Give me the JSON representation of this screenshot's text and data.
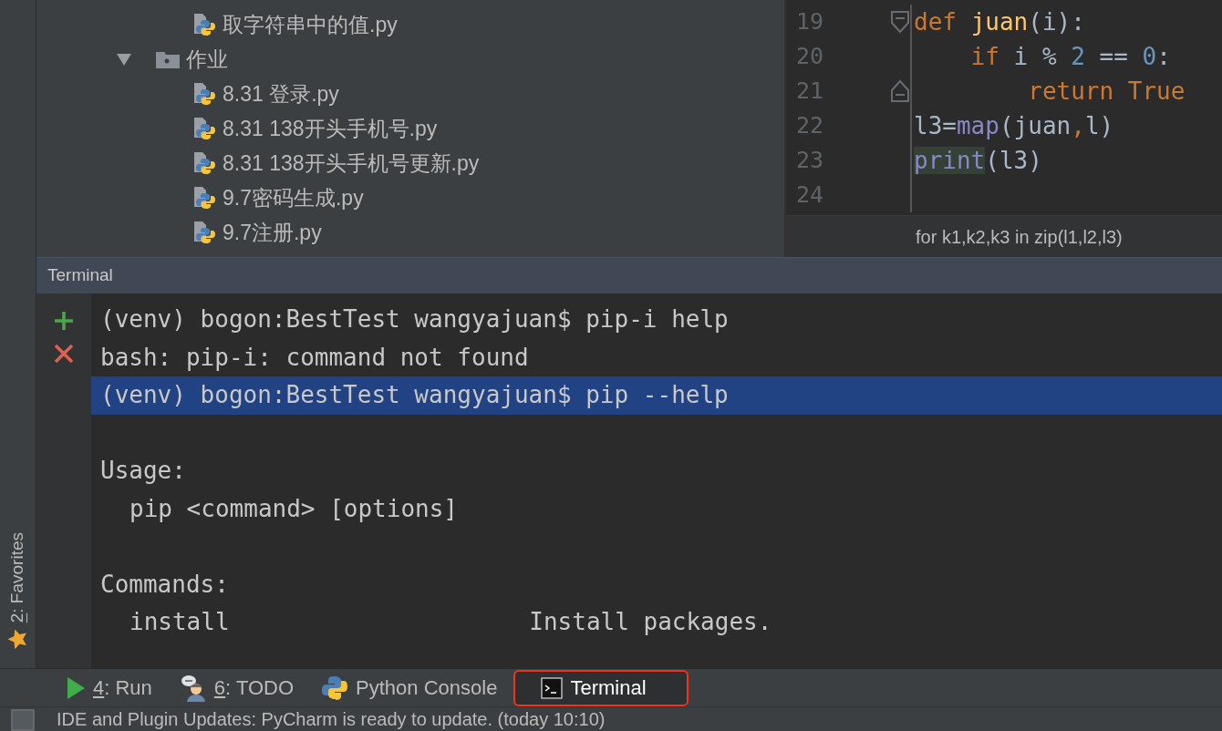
{
  "left_stripe": {
    "favorites": {
      "mnemonic": "2",
      "label": ": Favorites"
    }
  },
  "project_tree": {
    "items": [
      {
        "kind": "file",
        "label": "取字符串中的值.py"
      },
      {
        "kind": "folder",
        "label": "作业",
        "expanded": true,
        "children": [
          {
            "kind": "file",
            "label": "8.31 登录.py"
          },
          {
            "kind": "file",
            "label": "8.31 138开头手机号.py"
          },
          {
            "kind": "file",
            "label": "8.31 138开头手机号更新.py"
          },
          {
            "kind": "file",
            "label": "9.7密码生成.py"
          },
          {
            "kind": "file",
            "label": "9.7注册.py"
          }
        ]
      }
    ]
  },
  "editor": {
    "lines": [
      {
        "number": "19",
        "fold_start": true,
        "fold_end": false,
        "tokens": [
          {
            "kind": "keyword",
            "text": "def "
          },
          {
            "kind": "function",
            "text": "juan"
          },
          {
            "kind": "plain",
            "text": "(i):"
          }
        ]
      },
      {
        "number": "20",
        "fold_start": false,
        "fold_end": false,
        "tokens": [
          {
            "kind": "keyword",
            "text": "    if "
          },
          {
            "kind": "plain",
            "text": "i % "
          },
          {
            "kind": "number",
            "text": "2"
          },
          {
            "kind": "plain",
            "text": " == "
          },
          {
            "kind": "number",
            "text": "0"
          },
          {
            "kind": "plain",
            "text": ":"
          }
        ]
      },
      {
        "number": "21",
        "fold_start": false,
        "fold_end": true,
        "tokens": [
          {
            "kind": "keyword",
            "text": "        return True"
          }
        ]
      },
      {
        "number": "22",
        "fold_start": false,
        "fold_end": false,
        "tokens": [
          {
            "kind": "plain",
            "text": "l3="
          },
          {
            "kind": "builtin",
            "text": "map"
          },
          {
            "kind": "plain",
            "text": "(juan"
          },
          {
            "kind": "keyword",
            "text": ","
          },
          {
            "kind": "plain",
            "text": "l)"
          }
        ]
      },
      {
        "number": "23",
        "fold_start": false,
        "fold_end": false,
        "tokens": [
          {
            "kind": "builtin-marked",
            "text": "print"
          },
          {
            "kind": "plain",
            "text": "(l3)"
          }
        ]
      },
      {
        "number": "24",
        "fold_start": false,
        "fold_end": false
      }
    ],
    "breadcrumb": "for k1,k2,k3 in zip(l1,l2,l3)"
  },
  "terminal": {
    "title": "Terminal",
    "lines": [
      {
        "kind": "line",
        "text": "(venv) bogon:BestTest wangyajuan$ pip-i help",
        "selected": false
      },
      {
        "kind": "line",
        "text": "bash: pip-i: command not found",
        "selected": false
      },
      {
        "kind": "line",
        "text": "(venv) bogon:BestTest wangyajuan$ pip --help",
        "selected": true
      },
      {
        "kind": "section",
        "text": "Usage:",
        "selected": false
      },
      {
        "kind": "indented",
        "text": "pip <command> [options]",
        "selected": false
      },
      {
        "kind": "section",
        "text": "Commands:",
        "selected": false
      },
      {
        "kind": "command",
        "name": "install",
        "description": "Install packages.",
        "selected": false
      }
    ]
  },
  "tool_tabs": [
    {
      "kind": "run",
      "mnemonic": "4",
      "label": ": Run",
      "selected": false
    },
    {
      "kind": "todo",
      "mnemonic": "6",
      "label": ": TODO",
      "selected": false
    },
    {
      "kind": "python",
      "label": "Python Console",
      "selected": false
    },
    {
      "kind": "terminal",
      "label": "Terminal",
      "selected": true
    }
  ],
  "status_bar": {
    "message": "IDE and Plugin Updates: PyCharm is ready to update. (today 10:10)"
  }
}
